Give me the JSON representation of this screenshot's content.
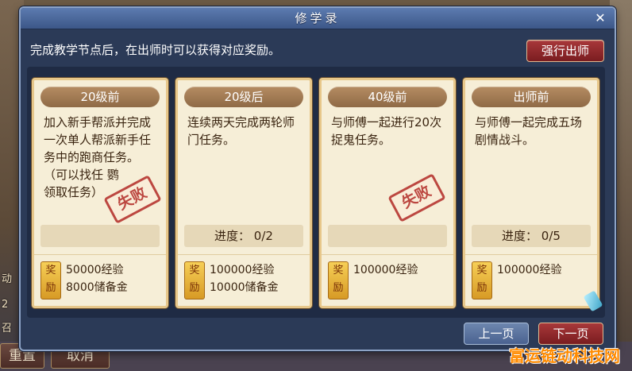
{
  "window": {
    "title": "修学录",
    "close_glyph": "✕",
    "instruction": "完成教学节点后，在出师时可以获得对应奖励。",
    "force_graduate_label": "强行出师"
  },
  "cards": [
    {
      "header": "20级前",
      "description": "加入新手帮派并完成一次单人帮派新手任务中的跑商任务。\n（可以找任  鹦\n领取任务）",
      "progress": "",
      "stamp": "失败",
      "reward_badge": "奖\n励",
      "reward_lines": "50000经验\n8000储备金"
    },
    {
      "header": "20级后",
      "description": "连续两天完成两轮师门任务。",
      "progress": "进度： 0/2",
      "stamp": "",
      "reward_badge": "奖\n励",
      "reward_lines": "100000经验\n10000储备金"
    },
    {
      "header": "40级前",
      "description": "与师傅一起进行20次捉鬼任务。",
      "progress": "",
      "stamp": "失败",
      "reward_badge": "奖\n励",
      "reward_lines": "100000经验"
    },
    {
      "header": "出师前",
      "description": "与师傅一起完成五场剧情战斗。",
      "progress": "进度： 0/5",
      "stamp": "",
      "reward_badge": "奖\n励",
      "reward_lines": "100000经验"
    }
  ],
  "pagination": {
    "prev_label": "上一页",
    "next_label": "下一页"
  },
  "background": {
    "side_texts": [
      "动",
      "2",
      "召"
    ],
    "bottom_buttons": [
      "重置",
      "取消"
    ]
  },
  "watermark": "富运链动科技网",
  "colors": {
    "window_bg": "#2b3a57",
    "card_bg": "#f6eed7",
    "accent_red": "#a8383a",
    "stamp_red": "#b22a26"
  }
}
